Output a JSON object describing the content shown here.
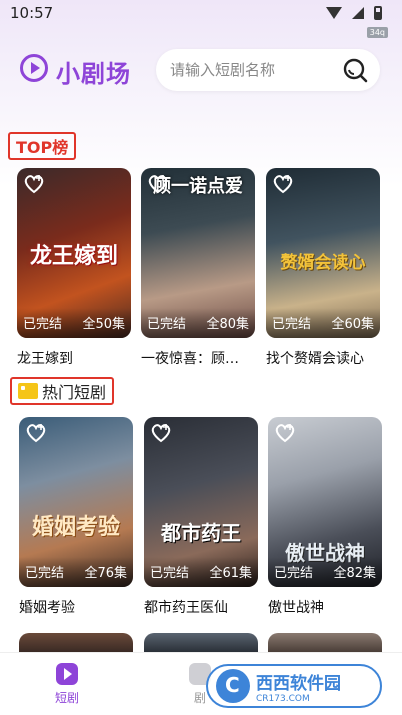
{
  "status_bar": {
    "time": "10:57",
    "fps_badge": "34q"
  },
  "header": {
    "app_name": "小剧场",
    "search_placeholder": "请输入短剧名称"
  },
  "sections": {
    "top": {
      "title": "TOP榜"
    },
    "hot": {
      "title": "热门短剧"
    }
  },
  "top_cards": [
    {
      "title": "龙王嫁到",
      "status": "已完结",
      "episodes": "全50集",
      "art_text": "龙王嫁到"
    },
    {
      "title": "一夜惊喜：顾…",
      "status": "已完结",
      "episodes": "全80集",
      "art_text": "顾一诺点爱"
    },
    {
      "title": "找个赘婿会读心",
      "status": "已完结",
      "episodes": "全60集",
      "art_text": "赘婿会读心"
    }
  ],
  "hot_cards": [
    {
      "title": "婚姻考验",
      "status": "已完结",
      "episodes": "全76集",
      "art_text": "婚姻考验"
    },
    {
      "title": "都市药王医仙",
      "status": "已完结",
      "episodes": "全61集",
      "art_text": "都市药王"
    },
    {
      "title": "傲世战神",
      "status": "已完结",
      "episodes": "全82集",
      "art_text": "傲世战神"
    }
  ],
  "tab_bar": {
    "tabs": [
      {
        "label": "短剧"
      },
      {
        "label": "剧"
      }
    ],
    "accent": "#8e44d8"
  },
  "watermark": {
    "main": "西西软件园",
    "sub": "CR173.COM"
  },
  "colors": {
    "accent": "#8e44d8",
    "section_border": "#e0352a"
  },
  "icons": [
    "logo-play-icon",
    "search-icon",
    "heart-icon",
    "crown-icon",
    "play-tab-icon"
  ]
}
